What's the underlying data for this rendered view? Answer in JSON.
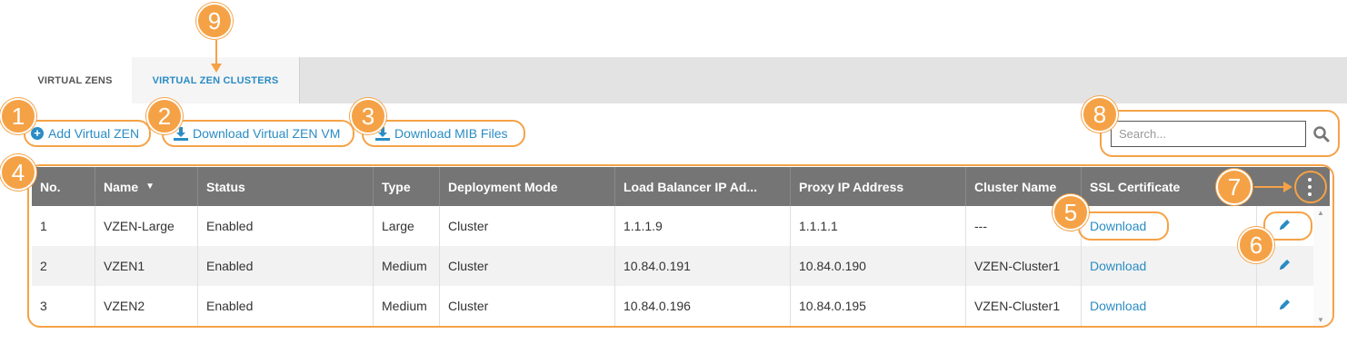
{
  "tabs": [
    {
      "label": "VIRTUAL ZENS"
    },
    {
      "label": "VIRTUAL ZEN CLUSTERS"
    }
  ],
  "actions": {
    "add": "Add Virtual ZEN",
    "download_vm": "Download Virtual ZEN VM",
    "download_mib": "Download MIB Files"
  },
  "search": {
    "placeholder": "Search..."
  },
  "table": {
    "columns": [
      "No.",
      "Name",
      "Status",
      "Type",
      "Deployment Mode",
      "Load Balancer IP Ad...",
      "Proxy IP Address",
      "Cluster Name",
      "SSL Certificate"
    ],
    "rows": [
      {
        "no": "1",
        "name": "VZEN-Large",
        "status": "Enabled",
        "type": "Large",
        "mode": "Cluster",
        "lb_ip": "1.1.1.9",
        "proxy_ip": "1.1.1.1",
        "cluster": "---",
        "ssl": "Download"
      },
      {
        "no": "2",
        "name": "VZEN1",
        "status": "Enabled",
        "type": "Medium",
        "mode": "Cluster",
        "lb_ip": "10.84.0.191",
        "proxy_ip": "10.84.0.190",
        "cluster": "VZEN-Cluster1",
        "ssl": "Download"
      },
      {
        "no": "3",
        "name": "VZEN2",
        "status": "Enabled",
        "type": "Medium",
        "mode": "Cluster",
        "lb_ip": "10.84.0.196",
        "proxy_ip": "10.84.0.195",
        "cluster": "VZEN-Cluster1",
        "ssl": "Download"
      }
    ]
  },
  "callouts": [
    "1",
    "2",
    "3",
    "4",
    "5",
    "6",
    "7",
    "8",
    "9"
  ],
  "colors": {
    "accent": "#2a8cc4",
    "callout": "#f5a247",
    "header_bg": "#757575"
  }
}
